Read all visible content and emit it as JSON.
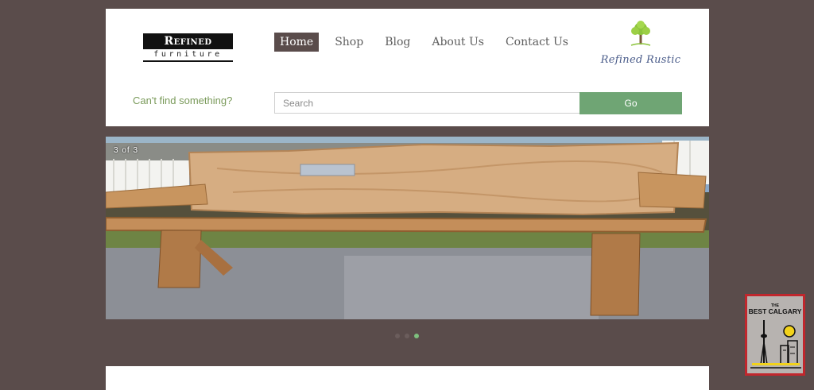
{
  "header": {
    "logo": {
      "line1": "Refined Rustic",
      "line2": "furniture"
    },
    "brand_logo_text": "Refined Rustic",
    "nav": [
      {
        "label": "Home",
        "active": true
      },
      {
        "label": "Shop",
        "active": false
      },
      {
        "label": "Blog",
        "active": false
      },
      {
        "label": "About Us",
        "active": false
      },
      {
        "label": "Contact Us",
        "active": false
      }
    ]
  },
  "search": {
    "prompt": "Can't find something?",
    "placeholder": "Search",
    "value": "",
    "button_label": "Go"
  },
  "slider": {
    "counter": "3 of 3",
    "current": 3,
    "total": 3,
    "image_subject": "rustic log bench"
  },
  "badge": {
    "small_text": "THE",
    "title": "BEST CALGARY"
  },
  "colors": {
    "page_background": "#5a4c4b",
    "nav_active_background": "#5a4c4b",
    "go_button": "#6fa574",
    "prompt_text": "#7a9a5a",
    "active_dot": "#7ec07e",
    "badge_border": "#c0272d"
  },
  "icons": [
    "tree-logo-icon",
    "cn-tower-skyline-icon",
    "sun-icon"
  ]
}
